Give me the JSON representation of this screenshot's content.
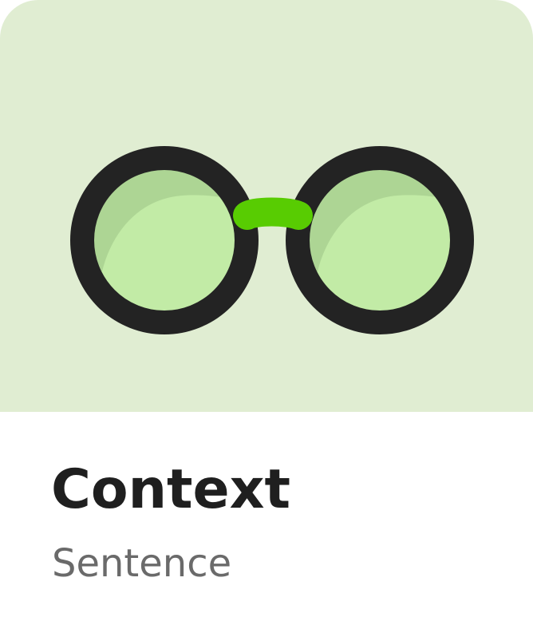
{
  "card": {
    "title": "Context",
    "subtitle": "Sentence"
  },
  "illustration": {
    "icon": "glasses-icon",
    "background_color": "#E0EDD2",
    "frame_color": "#232323",
    "lens_color": "#C2EBA6",
    "lens_shade_color": "#ADD594",
    "bridge_color": "#58CC02"
  }
}
